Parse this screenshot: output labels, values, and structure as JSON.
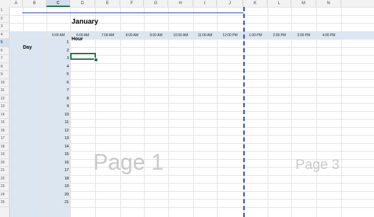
{
  "columns": [
    "A",
    "B",
    "C",
    "D",
    "E",
    "F",
    "G",
    "H",
    "I",
    "J",
    "K",
    "L",
    "M",
    "N"
  ],
  "selected_column": "C",
  "rows": [
    "1",
    "2",
    "3",
    "4",
    "5",
    "6",
    "7",
    "8",
    "9",
    "10",
    "11",
    "12",
    "13",
    "14",
    "15",
    "16",
    "17",
    "18",
    "19",
    "20",
    "21",
    "22",
    "23",
    "24",
    "25"
  ],
  "selected_row": "5",
  "sheet": {
    "title": "January",
    "hour_label": "Hour",
    "day_label": "Day",
    "times": [
      "5:00 AM",
      "6:00 AM",
      "7:00 AM",
      "8:00 AM",
      "9:00 AM",
      "10:00 AM",
      "11:00 AM",
      "12:00 PM",
      "1:00 PM",
      "2:00 PM",
      "3:00 PM",
      "4:00 PM"
    ],
    "days": [
      "1",
      "2",
      "3",
      "4",
      "5",
      "6",
      "7",
      "8",
      "9",
      "10",
      "11",
      "12",
      "13",
      "14",
      "15",
      "16",
      "17",
      "18",
      "19",
      "20",
      "21"
    ]
  },
  "watermarks": {
    "page1": "Page 1",
    "page3": "Page 3"
  },
  "colors": {
    "header_band": "#dce6f1",
    "selection": "#217346",
    "page_break": "#2f3fbf",
    "watermark": "#c9c9c9"
  }
}
